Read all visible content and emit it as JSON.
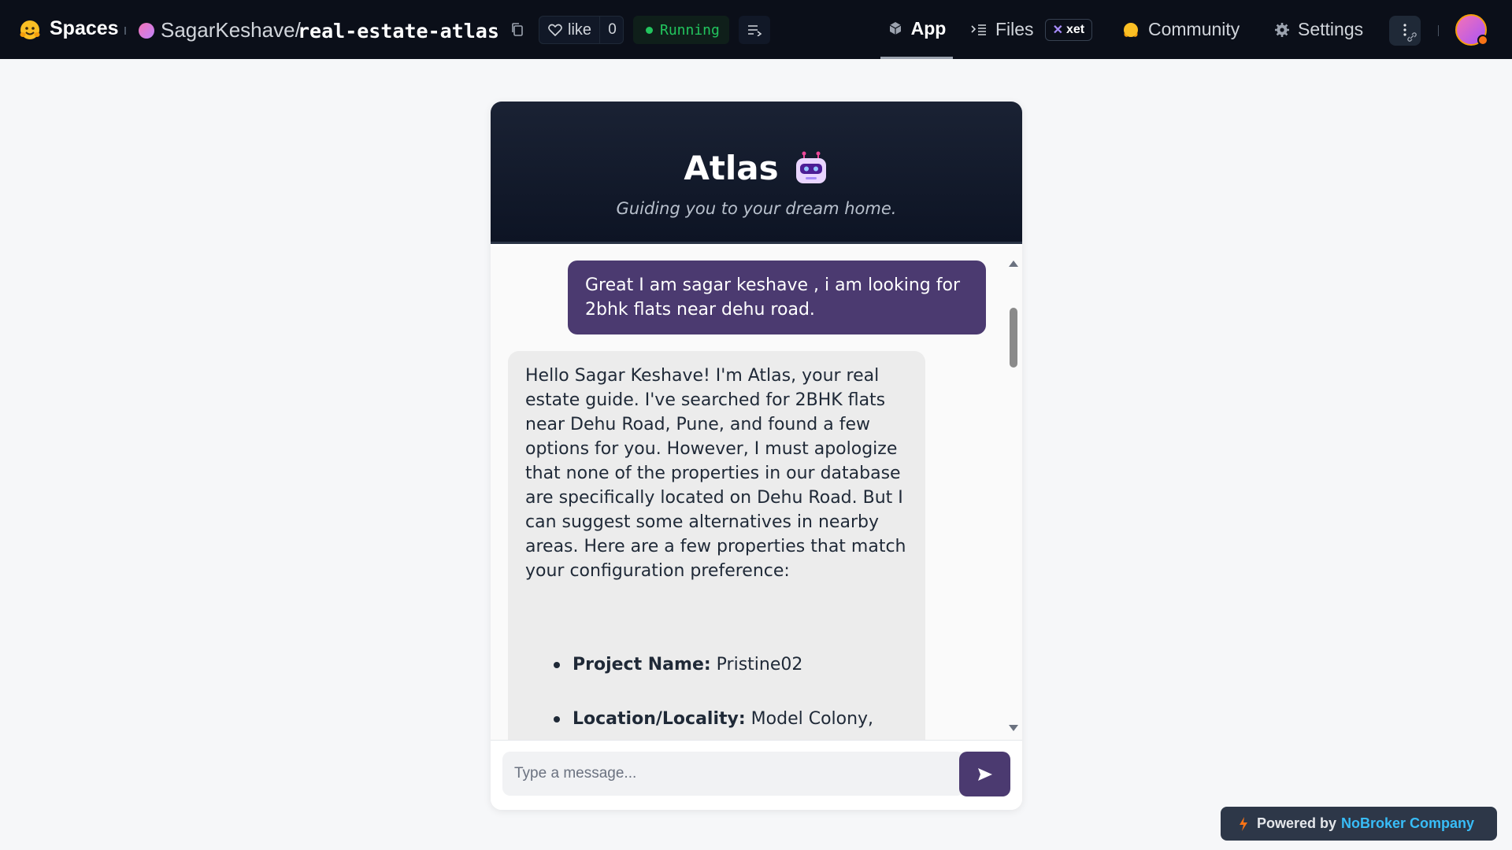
{
  "nav": {
    "spaces_label": "Spaces",
    "space_owner": "SagarKeshave",
    "space_slash": "/",
    "space_name": "real-estate-atlas",
    "like_label": "like",
    "like_count": "0",
    "status": "Running",
    "tabs": [
      {
        "label": "App"
      },
      {
        "label": "Files"
      },
      {
        "label": "Community"
      },
      {
        "label": "Settings"
      }
    ],
    "xet_badge": "xet",
    "status_color": "#22c55e"
  },
  "chat": {
    "title": "Atlas",
    "subtitle": "Guiding you to your dream home.",
    "messages": [
      {
        "role": "user",
        "text": "Great I am sagar keshave , i am looking for 2bhk flats near dehu road."
      },
      {
        "role": "bot",
        "text": "Hello Sagar Keshave! I'm Atlas, your real estate guide. I've searched for 2BHK flats near Dehu Road, Pune, and found a few options for you. However, I must apologize that none of the properties in our database are specifically located on Dehu Road. But I can suggest some alternatives in nearby areas. Here are a few properties that match your configuration preference:",
        "list": [
          {
            "key": "Project Name:",
            "value": "Pristine02"
          },
          {
            "key": "Location/Locality:",
            "value": "Model Colony,"
          }
        ]
      }
    ],
    "input_placeholder": "Type a message...",
    "accent_color": "#4b3a70"
  },
  "footer": {
    "powered_by": "Powered by",
    "brand": "NoBroker Company"
  }
}
